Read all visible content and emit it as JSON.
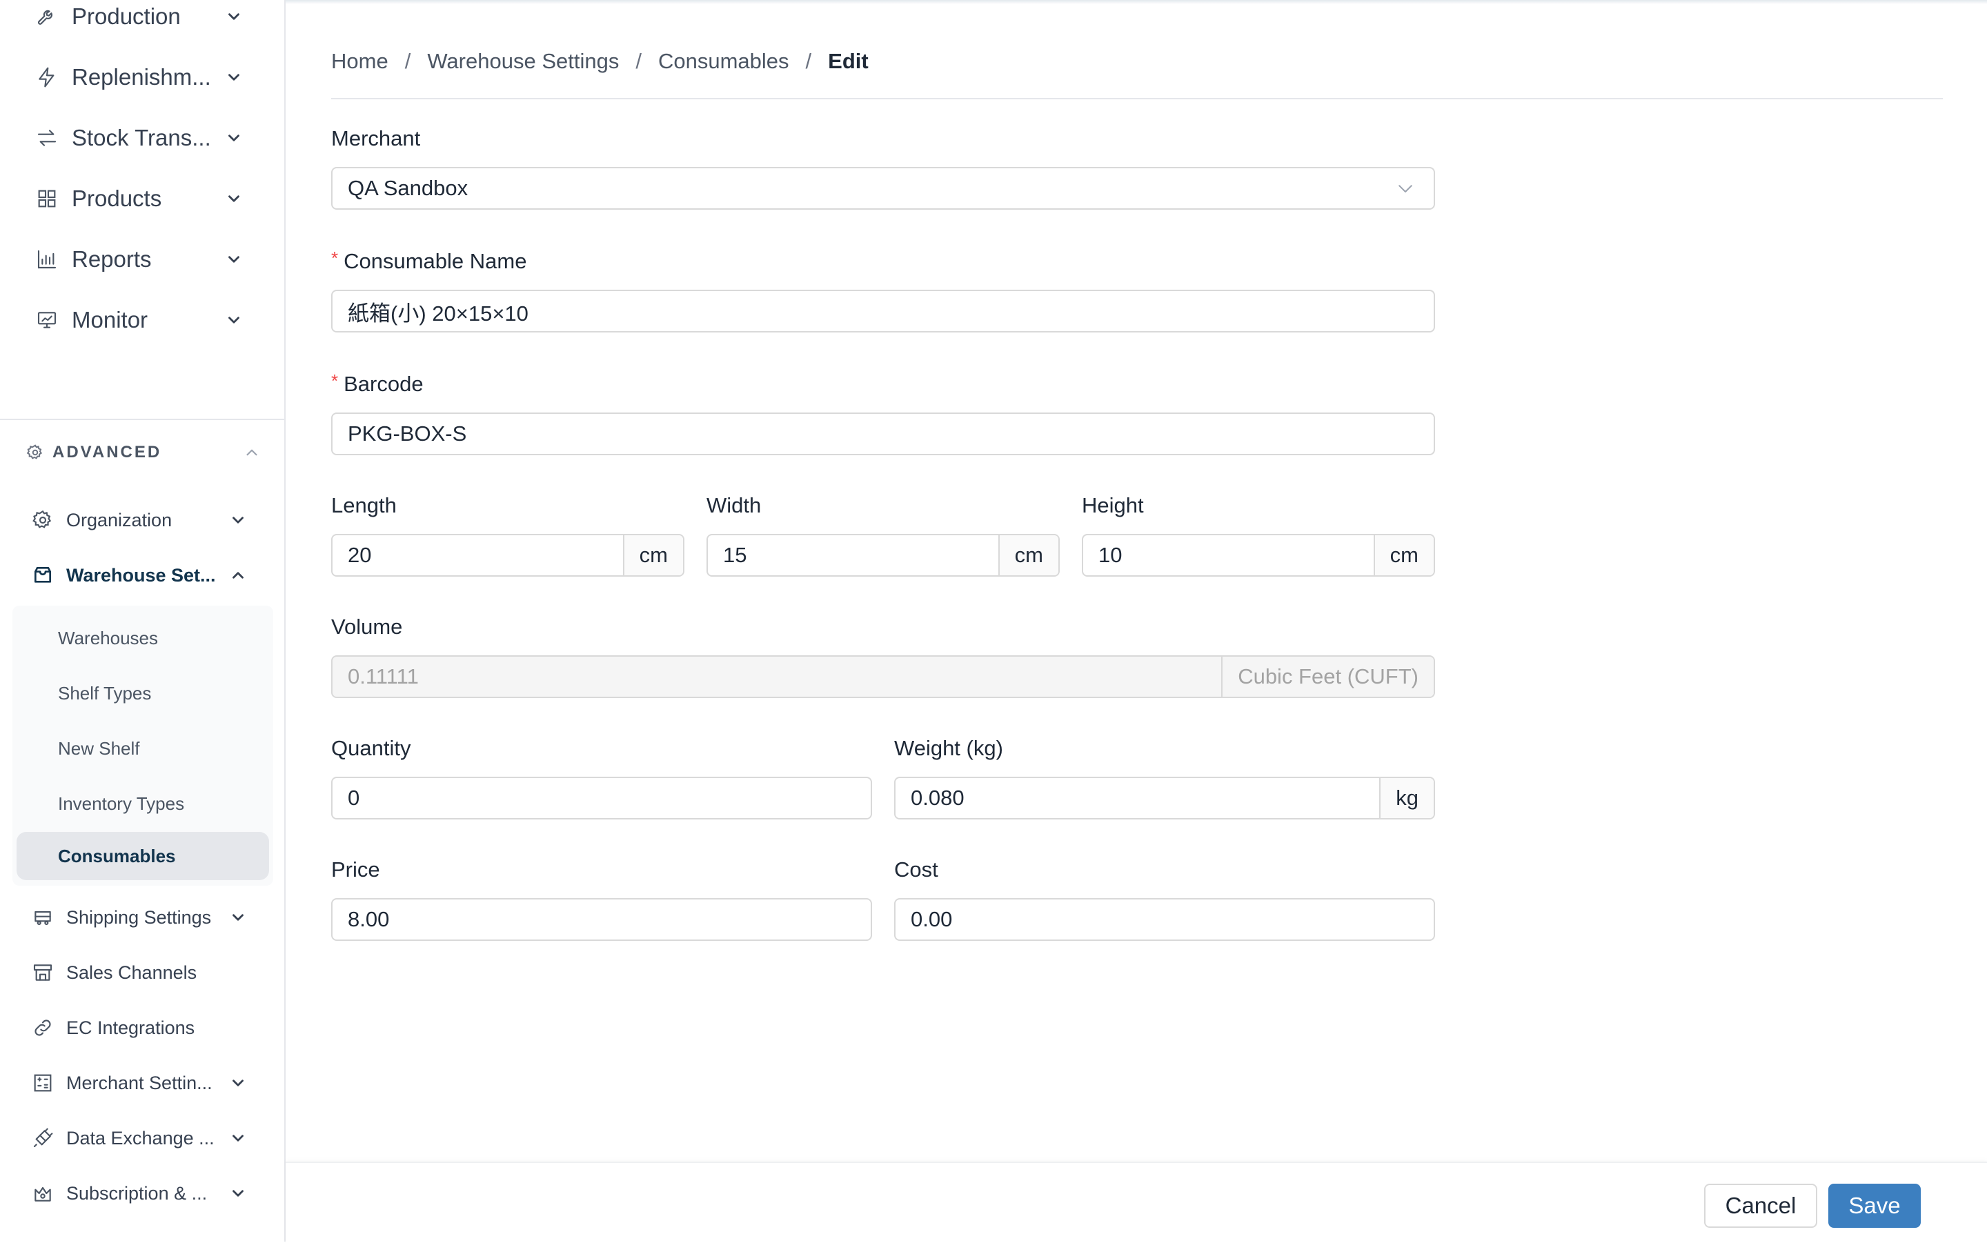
{
  "sidebar": {
    "top_items": [
      {
        "label": "Production",
        "icon": "wrench-icon"
      },
      {
        "label": "Replenishm...",
        "icon": "lightning-icon"
      },
      {
        "label": "Stock Trans...",
        "icon": "transfer-arrows-icon"
      },
      {
        "label": "Products",
        "icon": "grid-icon"
      },
      {
        "label": "Reports",
        "icon": "bar-chart-icon"
      },
      {
        "label": "Monitor",
        "icon": "monitor-chart-icon"
      }
    ],
    "advanced": {
      "title": "ADVANCED",
      "icon": "gear-icon",
      "items": [
        {
          "label": "Organization",
          "icon": "gear-icon"
        },
        {
          "label": "Warehouse Set...",
          "icon": "inbox-icon"
        },
        {
          "label": "Shipping Settings",
          "icon": "truck-icon"
        },
        {
          "label": "Sales Channels",
          "icon": "storefront-icon"
        },
        {
          "label": "EC Integrations",
          "icon": "link-icon"
        },
        {
          "label": "Merchant Settin...",
          "icon": "calculator-icon"
        },
        {
          "label": "Data Exchange ...",
          "icon": "plug-icon"
        },
        {
          "label": "Subscription & ...",
          "icon": "crown-icon"
        }
      ],
      "warehouse_submenu": [
        "Warehouses",
        "Shelf Types",
        "New Shelf",
        "Inventory Types",
        "Consumables"
      ]
    }
  },
  "breadcrumb": {
    "items": [
      "Home",
      "Warehouse Settings",
      "Consumables"
    ],
    "current": "Edit",
    "separator": "/"
  },
  "form": {
    "merchant": {
      "label": "Merchant",
      "value": "QA Sandbox"
    },
    "consumable_name": {
      "label": "Consumable Name",
      "value": "紙箱(小) 20×15×10",
      "required_mark": "*"
    },
    "barcode": {
      "label": "Barcode",
      "value": "PKG-BOX-S",
      "required_mark": "*"
    },
    "length": {
      "label": "Length",
      "value": "20",
      "unit": "cm"
    },
    "width": {
      "label": "Width",
      "value": "15",
      "unit": "cm"
    },
    "height": {
      "label": "Height",
      "value": "10",
      "unit": "cm"
    },
    "volume": {
      "label": "Volume",
      "value": "0.11111",
      "unit": "Cubic Feet (CUFT)"
    },
    "quantity": {
      "label": "Quantity",
      "value": "0"
    },
    "weight": {
      "label": "Weight (kg)",
      "value": "0.080",
      "unit": "kg"
    },
    "price": {
      "label": "Price",
      "value": "8.00"
    },
    "cost": {
      "label": "Cost",
      "value": "0.00"
    }
  },
  "footer": {
    "cancel_label": "Cancel",
    "save_label": "Save"
  },
  "colors": {
    "primary": "#3c7fc0",
    "active_text": "#12344d",
    "required": "#ef4444"
  }
}
